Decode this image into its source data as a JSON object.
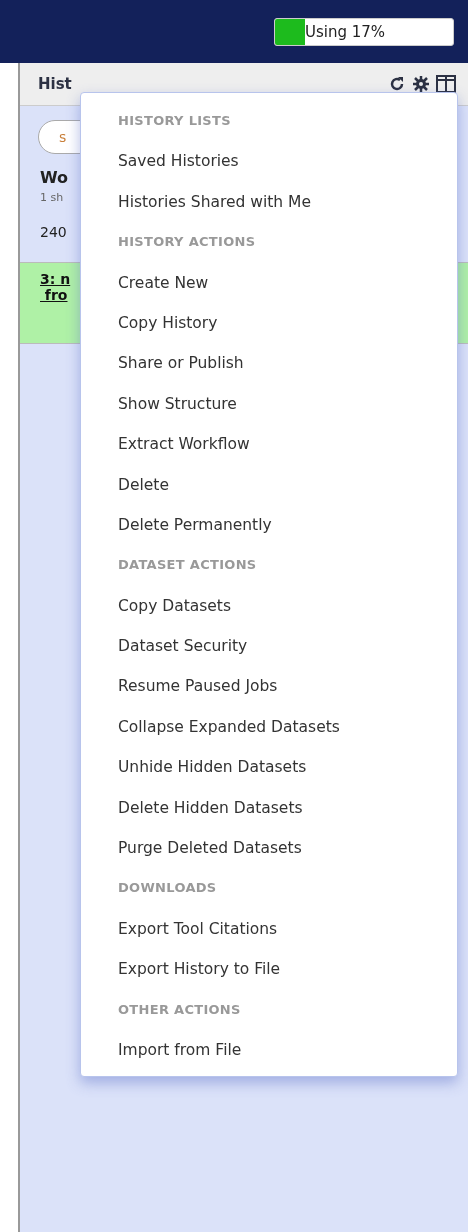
{
  "masthead": {
    "quota": {
      "label": "Using 17%",
      "level": 0.17
    }
  },
  "history_panel": {
    "title": "Hist",
    "search": {
      "placeholder": "s"
    },
    "name": "Wo",
    "summary": "1 sh",
    "size": "240",
    "datasets": [
      {
        "title": "3: n",
        "subtitle": "fro"
      }
    ]
  },
  "options_menu": {
    "sections": [
      {
        "header": "HISTORY LISTS",
        "items": [
          "Saved Histories",
          "Histories Shared with Me"
        ]
      },
      {
        "header": "HISTORY ACTIONS",
        "items": [
          "Create New",
          "Copy History",
          "Share or Publish",
          "Show Structure",
          "Extract Workflow",
          "Delete",
          "Delete Permanently"
        ]
      },
      {
        "header": "DATASET ACTIONS",
        "items": [
          "Copy Datasets",
          "Dataset Security",
          "Resume Paused Jobs",
          "Collapse Expanded Datasets",
          "Unhide Hidden Datasets",
          "Delete Hidden Datasets",
          "Purge Deleted Datasets"
        ]
      },
      {
        "header": "DOWNLOADS",
        "items": [
          "Export Tool Citations",
          "Export History to File"
        ]
      },
      {
        "header": "OTHER ACTIONS",
        "items": [
          "Import from File"
        ]
      }
    ]
  }
}
